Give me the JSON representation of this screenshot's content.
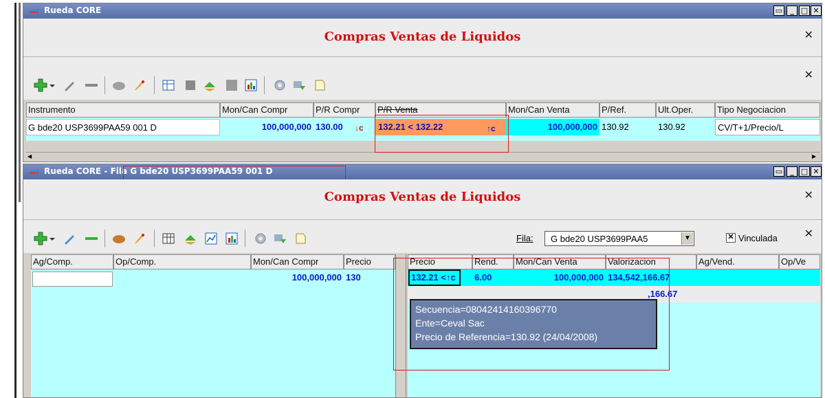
{
  "window1": {
    "title": "Rueda CORE",
    "header_title": "Compras Ventas de Liquidos",
    "columns": [
      "Instrumento",
      "Mon/Can Compr",
      "P/R Compr",
      "P/R Venta",
      "Mon/Can Venta",
      "P/Ref.",
      "Ult.Oper.",
      "Tipo Negociacion"
    ],
    "row": {
      "instrumento": "G bde20 USP3699PAA59 001 D",
      "mon_can_compra": "100,000,000",
      "pr_compra": "130.00",
      "pr_venta": "132.21 < 132.22",
      "mon_can_venta": "100,000,000",
      "p_ref": "130.92",
      "ult_oper": "130.92",
      "tipo_negociacion": "CV/T+1/Precio/L"
    },
    "arrow_down": "↓c",
    "arrow_up": "↑c"
  },
  "window2": {
    "title": "Rueda CORE - Fila G bde20 USP3699PAA59 001 D",
    "header_title": "Compras Ventas de Liquidos",
    "fila_label": "Fila:",
    "fila_value": "G bde20 USP3699PAA5",
    "vinculada_label": "Vinculada",
    "vinculada_checked": true,
    "left_columns": [
      "Ag/Comp.",
      "Op/Comp.",
      "Mon/Can Compr",
      "Precio"
    ],
    "left_row": {
      "mon_can": "100,000,000",
      "precio": "130"
    },
    "right_columns": [
      "Precio",
      "Rend.",
      "Mon/Can Venta",
      "Valorizacion",
      "Ag/Vend.",
      "Op/Ve"
    ],
    "right_rows": [
      {
        "precio": "132.21 <↑c",
        "rend": "6.00",
        "mon_can": "100,000,000",
        "valorizacion": "134,542,166.67"
      },
      {
        "valorizacion": ",166.67"
      }
    ],
    "tooltip": {
      "line1": "Secuencia=08042414160396770",
      "line2": "Ente=Ceval Sac",
      "line3": "Precio de Referencia=130.92 (24/04/2008)"
    }
  },
  "colors": {
    "title_red": "#d21010",
    "value_blue": "#0a18c8",
    "cyan_bg": "#00ffff",
    "light_cyan": "#b8ffff",
    "orange_cell": "#ff9a5c",
    "highlight_box": "#e0141a"
  }
}
